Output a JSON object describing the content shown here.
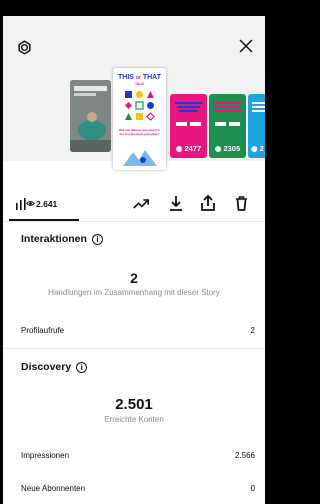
{
  "header": {
    "settings_icon": "settings-icon",
    "close_icon": "close-icon"
  },
  "stories": [
    {
      "kind": "photo",
      "views": ""
    },
    {
      "kind": "this-or-that",
      "title_this": "THIS",
      "title_or": "or",
      "title_that": "THAT",
      "subtitle": "TALK",
      "text": "Wie viel Männer-Innenwelt in der Gesellschaft vertretbar?"
    },
    {
      "kind": "color",
      "color": "#e8177f",
      "views": "2477"
    },
    {
      "kind": "color",
      "color": "#1d8f4f",
      "views": "2305"
    },
    {
      "kind": "color",
      "color": "#1ba5e0",
      "views": "2"
    }
  ],
  "toolbar": {
    "views": "2.641",
    "chart_icon": "bar-chart-icon",
    "eye_icon": "eye-icon",
    "trend_icon": "trending-icon",
    "download_icon": "download-icon",
    "share_icon": "share-icon",
    "delete_icon": "trash-icon"
  },
  "interactions": {
    "title": "Interaktionen",
    "count": "2",
    "caption": "Handlungen im Zusammenhang mit dieser Story",
    "rows": [
      {
        "label": "Profilaufrufe",
        "value": "2"
      }
    ]
  },
  "discovery": {
    "title": "Discovery",
    "count": "2.501",
    "caption": "Erreichte Konten",
    "rows": [
      {
        "label": "Impressionen",
        "value": "2.566"
      },
      {
        "label": "Neue Abonnenten",
        "value": "0"
      }
    ]
  }
}
